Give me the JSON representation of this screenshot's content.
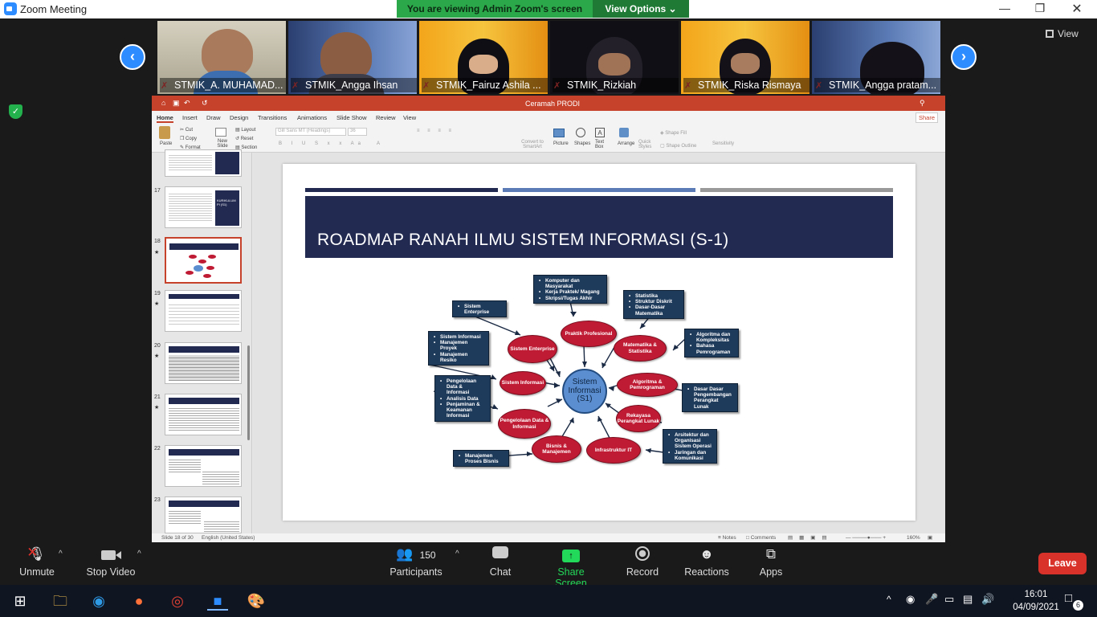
{
  "window": {
    "title": "Zoom Meeting"
  },
  "banner": {
    "viewing": "You are viewing Admin Zoom's screen",
    "options": "View Options ⌄"
  },
  "view_button": "View",
  "participants_strip": [
    {
      "name": "STMIK_A. MUHAMAD..."
    },
    {
      "name": "STMIK_Angga Ihsan"
    },
    {
      "name": "STMIK_Fairuz Ashila ..."
    },
    {
      "name": "STMIK_Rizkiah"
    },
    {
      "name": "STMIK_Riska Rismaya"
    },
    {
      "name": "STMIK_Angga pratam..."
    }
  ],
  "powerpoint": {
    "doc_title": "Ceramah PRODI",
    "tabs": [
      "Home",
      "Insert",
      "Draw",
      "Design",
      "Transitions",
      "Animations",
      "Slide Show",
      "Review",
      "View"
    ],
    "share": "Share",
    "ribbon": {
      "paste": "Paste",
      "cut": "Cut",
      "copy": "Copy",
      "format": "Format",
      "new_slide": "New Slide",
      "layout": "Layout",
      "reset": "Reset",
      "section": "Section",
      "font": "Gill Sans MT (Headings)",
      "size": "36",
      "convert": "Convert to SmartArt",
      "picture": "Picture",
      "shapes": "Shapes",
      "textbox": "Text Box",
      "arrange": "Arrange",
      "quick_styles": "Quick Styles",
      "shape_fill": "Shape Fill",
      "shape_outline": "Shape Outline",
      "sensitivity": "Sensitivity"
    },
    "thumb_numbers": [
      "17",
      "18",
      "19",
      "20",
      "21",
      "22",
      "23"
    ],
    "thumb_captions": {
      "t17": "KURIKULUM PI (S1)"
    },
    "status": {
      "slide": "Slide 18 of 30",
      "lang": "English (United States)",
      "notes": "Notes",
      "comments": "Comments",
      "zoom": "160%"
    },
    "slide": {
      "title": "ROADMAP  RANAH ILMU SISTEM INFORMASI (S-1)",
      "center": "Sistem Informasi (S1)",
      "nodes": [
        "Praktik Profesional",
        "Matematika & Statistika",
        "Algoritma & Pemrograman",
        "Rekayasa Perangkat Lunak",
        "Infrastruktur IT",
        "Bisnis & Manajemen",
        "Pengelolaan Data & Informasi",
        "Sistem Informasi",
        "Sistem Enterprise"
      ],
      "boxes": {
        "komputer": [
          "Komputer dan Masyarakat",
          "Kerja Praktek/ Magang",
          "Skripsi/Tugas Akhir"
        ],
        "statistika": [
          "Statistika",
          "Struktur Diskrit",
          "Dasar-Dasar Matematika"
        ],
        "algoritma": [
          "Algoritma dan Kompleksitas",
          "Bahasa Pemrograman"
        ],
        "dasar": [
          "Dasar Dasar Pengembangan Perangkat Lunak"
        ],
        "arsitektur": [
          "Arsitektur dan Organisasi Sistem Operasi",
          "Jaringan dan Komunikasi"
        ],
        "mpb": [
          "Manajemen Proses Bisnis"
        ],
        "pengelolaan": [
          "Pengelolaan Data & Informasi",
          "Analisis Data",
          "Penjaminan & Keamanan Informasi"
        ],
        "simp": [
          "Sistem Informasi",
          "Manajemen Proyek",
          "Manajemen Resiko"
        ],
        "se": [
          "Sistem Enterprise"
        ]
      }
    }
  },
  "toolbar": {
    "unmute": "Unmute",
    "stop_video": "Stop Video",
    "participants": "Participants",
    "participants_count": "150",
    "chat": "Chat",
    "share": "Share Screen",
    "record": "Record",
    "reactions": "Reactions",
    "apps": "Apps",
    "leave": "Leave"
  },
  "taskbar": {
    "time": "16:01",
    "date": "04/09/2021",
    "notif": "6"
  },
  "colors": {
    "zoom_blue": "#2d8cff",
    "banner_green": "#2aa84a",
    "share_green": "#23d959",
    "leave_red": "#d9322b",
    "ppt_red": "#c6422b",
    "slide_navy": "#222a52",
    "node_red": "#c01b34"
  }
}
